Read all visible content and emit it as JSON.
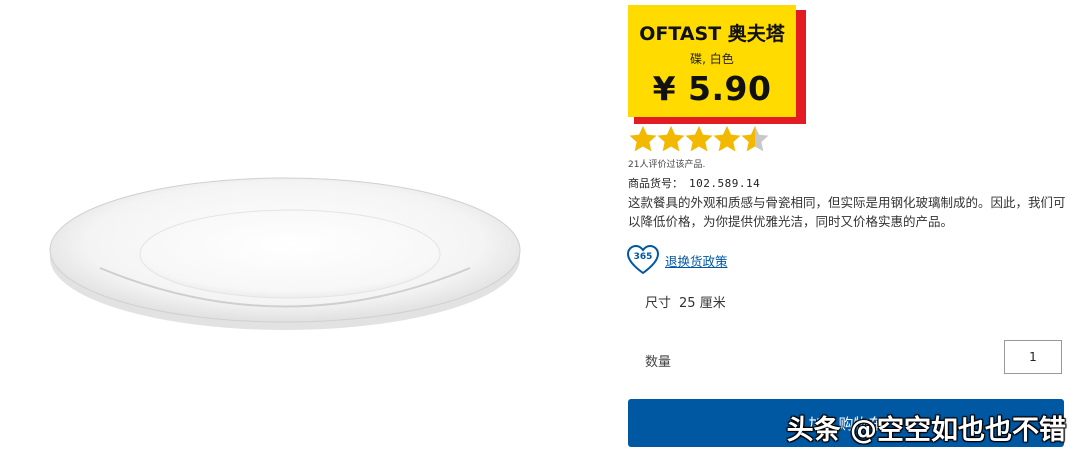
{
  "product": {
    "name": "OFTAST 奥夫塔",
    "subtitle": "碟, 白色",
    "price": "¥ 5.90",
    "rating": {
      "value": 4.5,
      "max": 5,
      "count_text": "21人评价过该产品."
    },
    "sku_label": "商品货号：",
    "sku_value": "102.589.14",
    "description": "这款餐具的外观和质感与骨瓷相同，但实际是用钢化玻璃制成的。因此，我们可以降低价格，为你提供优雅光洁，同时又价格实惠的产品。",
    "policy_badge": "365",
    "policy_link": "退换货政策",
    "size_label": "尺寸",
    "size_value": "25 厘米",
    "quantity_label": "数量",
    "quantity_value": "1",
    "buy_button": "加入购物车"
  },
  "watermark": "头条 @空空如也也不错",
  "colors": {
    "tag_yellow": "#ffdb00",
    "tag_red": "#e31b23",
    "star_gold": "#f2b900",
    "button_blue": "#0058a3",
    "link_blue": "#0058a3"
  },
  "icons": [
    "plate-image",
    "star-icon",
    "half-star-icon",
    "365-badge-icon"
  ]
}
